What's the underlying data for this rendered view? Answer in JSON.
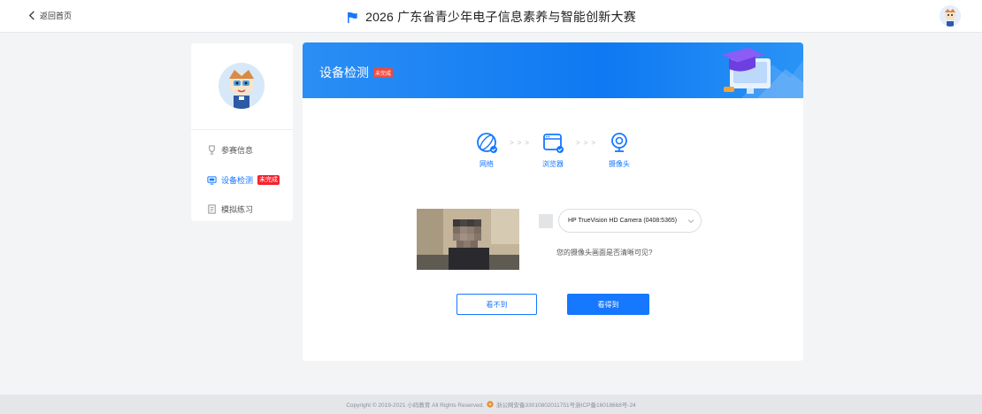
{
  "header": {
    "back_label": "返回首页",
    "title": "2026 广东省青少年电子信息素养与智能创新大赛"
  },
  "sidebar": {
    "items": [
      {
        "label": "参赛信息",
        "icon": "trophy-icon"
      },
      {
        "label": "设备检测",
        "icon": "device-icon",
        "badge": "未完成"
      },
      {
        "label": "模拟练习",
        "icon": "document-icon"
      }
    ]
  },
  "card": {
    "title": "设备检测",
    "badge": "未完成",
    "steps": [
      {
        "label": "网络",
        "icon": "network-globe-icon"
      },
      {
        "label": "浏览器",
        "icon": "browser-icon"
      },
      {
        "label": "摄像头",
        "icon": "camera-icon"
      }
    ],
    "camera_option": "HP TrueVision HD Camera (0408:5365)",
    "question": "您的摄像头画面是否清晰可见?",
    "btn_cant_see": "看不到",
    "btn_can_see": "看得到"
  },
  "footer": {
    "copyright": "Copyright © 2019-2021 小码教育 All Rights Reserved.",
    "record": "浙公网安备33010802011751号浙ICP备16018668号-24"
  },
  "colors": {
    "accent": "#1677ff",
    "badge_red": "#f5222d",
    "background": "#f3f4f6"
  }
}
